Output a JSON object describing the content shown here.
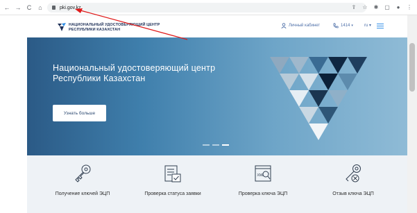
{
  "browser": {
    "back_icon": "←",
    "forward_icon": "→",
    "reload_icon": "C",
    "home_icon": "⌂",
    "url": "pki.gov.kz"
  },
  "header": {
    "logo_line1": "НАЦИОНАЛЬНЫЙ УДОСТОВЕРЯЮЩИЙ ЦЕНТР",
    "logo_line2": "РЕСПУБЛИКИ КАЗАХСТАН",
    "cabinet_label": "Личный кабинет",
    "phone_label": "1414",
    "phone_caret": "▾",
    "lang_label": "ru ▾"
  },
  "hero": {
    "title": "Национальный удостоверяющий центр Республики Казахстан",
    "button_label": "Узнать больше",
    "slides_total": 3,
    "slide_active": 3
  },
  "services": [
    {
      "label": "Получение ключей ЭЦП",
      "icon": "key-icon"
    },
    {
      "label": "Проверка статуса заявки",
      "icon": "document-check-icon"
    },
    {
      "label": "Проверка ключа ЭЦП",
      "icon": "certificate-search-icon"
    },
    {
      "label": "Отзыв ключа ЭЦП",
      "icon": "revoke-key-icon"
    }
  ],
  "colors": {
    "brand_blue": "#2e8de6",
    "navy": "#1d2f57",
    "annotation_red": "#e01b1b"
  }
}
